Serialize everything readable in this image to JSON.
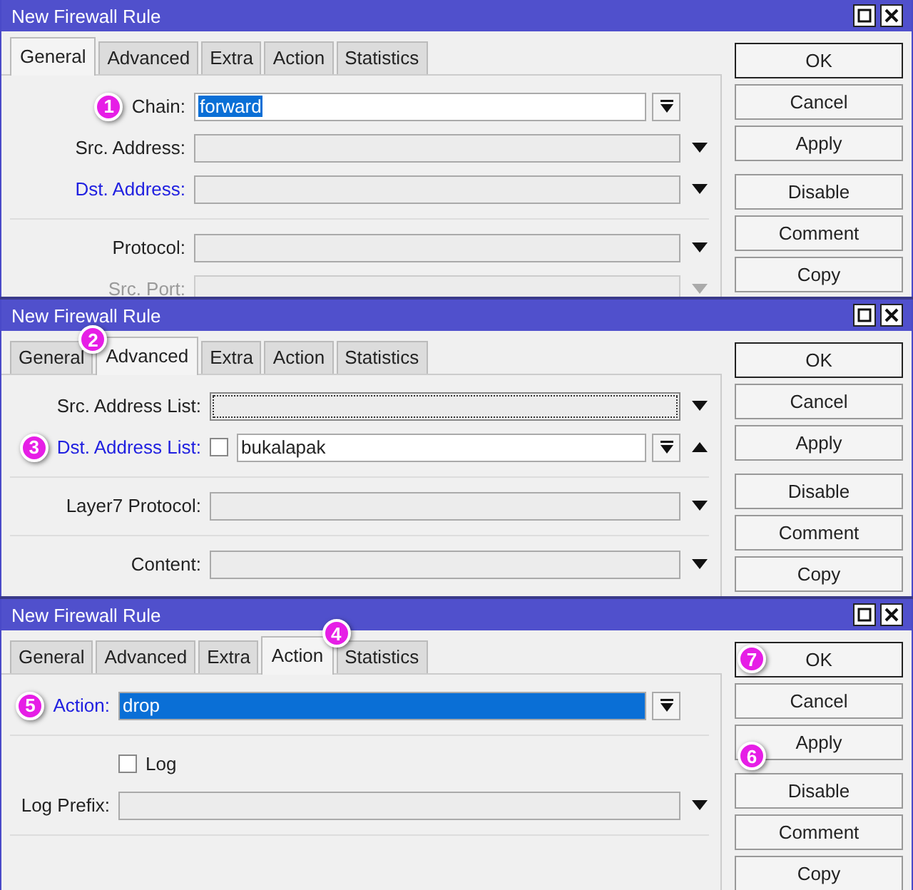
{
  "windows": [
    {
      "title": "New Firewall Rule",
      "tabs": [
        {
          "label": "General",
          "selected": true
        },
        {
          "label": "Advanced",
          "selected": false
        },
        {
          "label": "Extra",
          "selected": false
        },
        {
          "label": "Action",
          "selected": false
        },
        {
          "label": "Statistics",
          "selected": false
        }
      ],
      "rows": [
        {
          "kind": "combo",
          "label": "Chain:",
          "value": "forward",
          "selected": true,
          "badge": "1"
        },
        {
          "kind": "select",
          "label": "Src. Address:"
        },
        {
          "kind": "select",
          "label": "Dst. Address:",
          "active": true
        },
        {
          "kind": "divider"
        },
        {
          "kind": "select",
          "label": "Protocol:"
        },
        {
          "kind": "select",
          "label": "Src. Port:",
          "disabled": true
        }
      ],
      "buttons": [
        {
          "label": "OK"
        },
        {
          "label": "Cancel"
        },
        {
          "label": "Apply"
        },
        {
          "label": "Disable"
        },
        {
          "label": "Comment"
        },
        {
          "label": "Copy"
        }
      ]
    },
    {
      "title": "New Firewall Rule",
      "tabs": [
        {
          "label": "General",
          "selected": false
        },
        {
          "label": "Advanced",
          "selected": true,
          "badge": "2"
        },
        {
          "label": "Extra",
          "selected": false
        },
        {
          "label": "Action",
          "selected": false
        },
        {
          "label": "Statistics",
          "selected": false
        }
      ],
      "rows": [
        {
          "kind": "select",
          "label": "Src. Address List:",
          "focused": true
        },
        {
          "kind": "list",
          "label": "Dst. Address List:",
          "value": "bukalapak",
          "active": true,
          "checked": false,
          "expanded": true,
          "badge": "3"
        },
        {
          "kind": "divider"
        },
        {
          "kind": "select",
          "label": "Layer7 Protocol:"
        },
        {
          "kind": "divider"
        },
        {
          "kind": "select",
          "label": "Content:"
        }
      ],
      "buttons": [
        {
          "label": "OK"
        },
        {
          "label": "Cancel"
        },
        {
          "label": "Apply"
        },
        {
          "label": "Disable"
        },
        {
          "label": "Comment"
        },
        {
          "label": "Copy"
        }
      ]
    },
    {
      "title": "New Firewall Rule",
      "tabs": [
        {
          "label": "General",
          "selected": false
        },
        {
          "label": "Advanced",
          "selected": false
        },
        {
          "label": "Extra",
          "selected": false
        },
        {
          "label": "Action",
          "selected": true,
          "badge": "4"
        },
        {
          "label": "Statistics",
          "selected": false
        }
      ],
      "rows": [
        {
          "kind": "combo",
          "label": "Action:",
          "value": "drop",
          "selected": true,
          "focused": true,
          "active": true,
          "badge": "5"
        },
        {
          "kind": "divider"
        },
        {
          "kind": "check",
          "label": "Log",
          "checked": false
        },
        {
          "kind": "select",
          "label": "Log Prefix:"
        },
        {
          "kind": "divider"
        }
      ],
      "buttons": [
        {
          "label": "OK",
          "badge": "7"
        },
        {
          "label": "Cancel"
        },
        {
          "label": "Apply",
          "badge": "6"
        },
        {
          "label": "Disable"
        },
        {
          "label": "Comment"
        },
        {
          "label": "Copy"
        }
      ]
    }
  ]
}
